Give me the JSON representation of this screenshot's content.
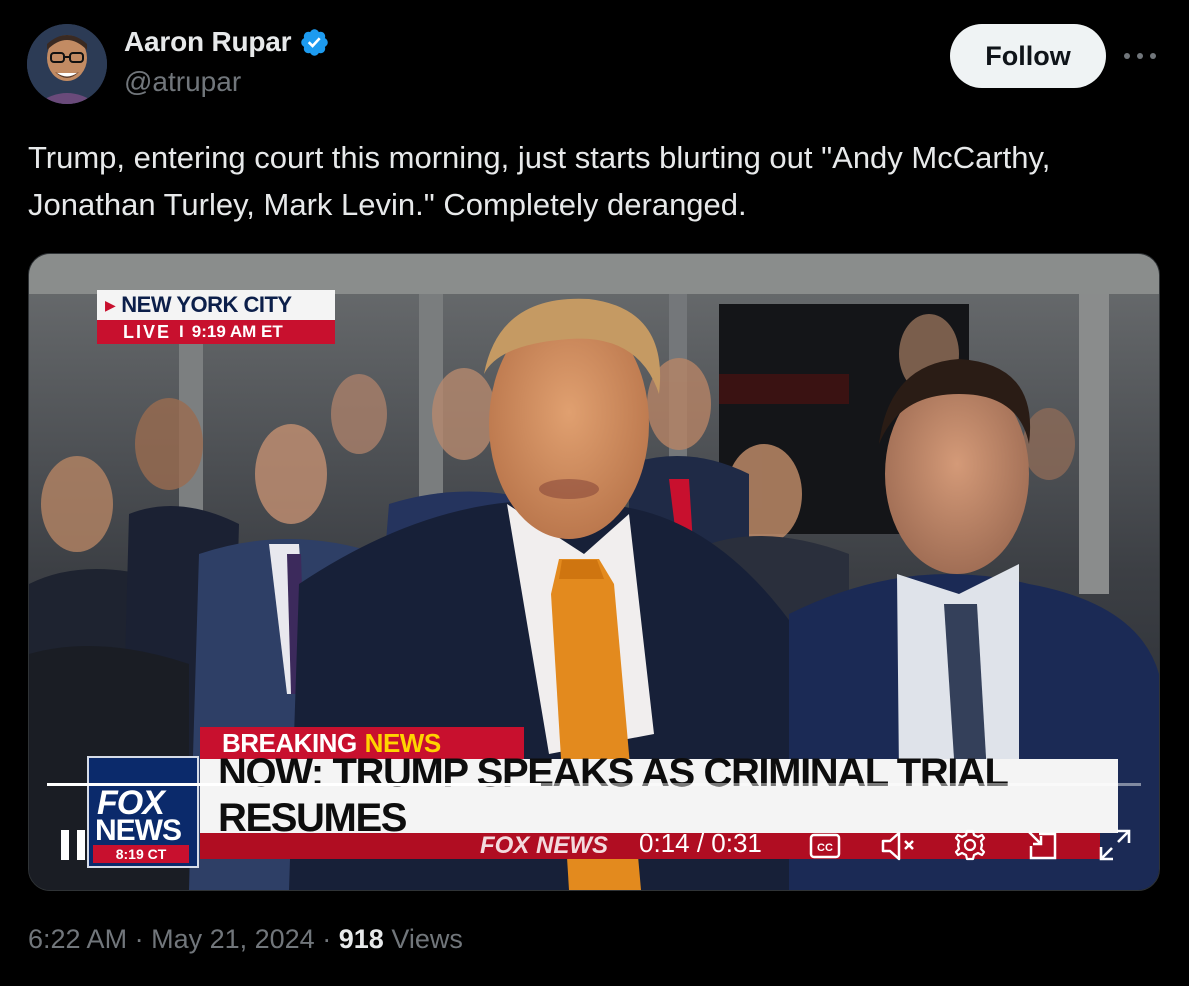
{
  "author": {
    "display_name": "Aaron Rupar",
    "handle": "@atrupar"
  },
  "actions": {
    "follow_label": "Follow"
  },
  "tweet": {
    "text": "Trump, entering court this morning, just starts blurting out \"Andy McCarthy, Jonathan Turley, Mark Levin.\" Completely deranged."
  },
  "video": {
    "location_label": "NEW YORK CITY",
    "live_label": "LIVE",
    "live_separator": "I",
    "live_time": "9:19 AM ET",
    "logo_fox": "FOX",
    "logo_news": "NEWS",
    "logo_time": "8:19 CT",
    "breaking_word1": "BREAKING",
    "breaking_word2": "NEWS",
    "headline": "NOW: TRUMP SPEAKS AS CRIMINAL TRIAL RESUMES",
    "ticker_brand": "FOX NEWS",
    "current_time": "0:14",
    "duration": "0:31",
    "time_display": "0:14 / 0:31",
    "progress_fraction": 0.452
  },
  "footer": {
    "time": "6:22 AM",
    "date": "May 21, 2024",
    "separator": "·",
    "views_count": "918",
    "views_label": "Views"
  },
  "colors": {
    "verified_blue": "#1d9bf0",
    "fox_red": "#c8102e",
    "fox_navy": "#0b2a6b",
    "news_yellow": "#ffd400"
  },
  "icons": {
    "verified": "verified-badge-icon",
    "more": "more-horizontal-icon",
    "pause": "pause-icon",
    "captions": "closed-captions-icon",
    "mute": "muted-speaker-icon",
    "settings": "gear-icon",
    "pip": "picture-in-picture-icon",
    "fullscreen": "fullscreen-expand-icon"
  }
}
